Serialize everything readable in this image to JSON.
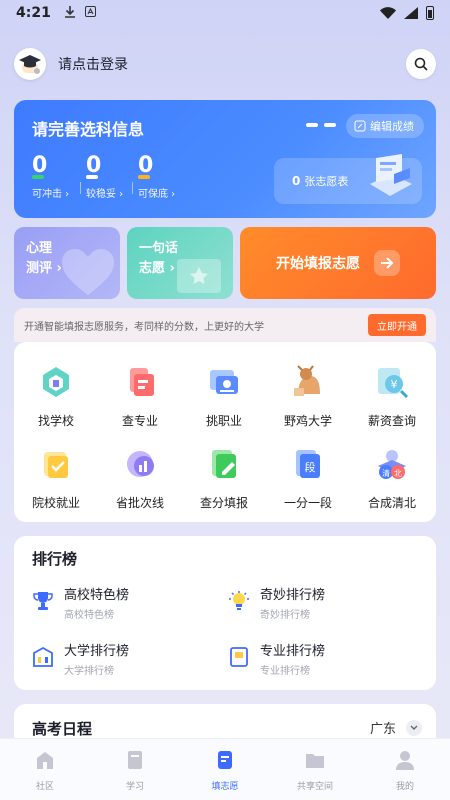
{
  "status_bar": {
    "time": "4:21"
  },
  "header": {
    "login_text": "请点击登录"
  },
  "info_card": {
    "title": "请完善选科信息",
    "edit_label": "编辑成绩",
    "stats": [
      {
        "value": "0",
        "label": "可冲击",
        "color": "#39d36b"
      },
      {
        "value": "0",
        "label": "较稳妥",
        "color": "#ffffff"
      },
      {
        "value": "0",
        "label": "可保底",
        "color": "#ffb020"
      }
    ],
    "volunteer_count": "0",
    "volunteer_label": "张志愿表"
  },
  "feature_cards": {
    "psych": {
      "line1": "心理",
      "line2": "测评"
    },
    "wish": {
      "line1": "一句话",
      "line2": "志愿"
    },
    "start_label": "开始填报志愿"
  },
  "promo": {
    "text": "开通智能填报志愿服务，考同样的分数，上更好的大学",
    "button": "立即开通"
  },
  "tools": [
    {
      "label": "找学校",
      "icon": "school-icon"
    },
    {
      "label": "查专业",
      "icon": "major-icon"
    },
    {
      "label": "挑职业",
      "icon": "career-icon"
    },
    {
      "label": "野鸡大学",
      "icon": "fake-university-icon"
    },
    {
      "label": "薪资查询",
      "icon": "salary-icon"
    },
    {
      "label": "院校就业",
      "icon": "employment-icon"
    },
    {
      "label": "省批次线",
      "icon": "batch-line-icon"
    },
    {
      "label": "查分填报",
      "icon": "score-report-icon"
    },
    {
      "label": "一分一段",
      "icon": "score-segment-icon"
    },
    {
      "label": "合成清北",
      "icon": "qingbei-game-icon"
    }
  ],
  "rankings": {
    "title": "排行榜",
    "items": [
      {
        "title": "高校特色榜",
        "subtitle": "高校特色榜",
        "icon": "trophy-icon"
      },
      {
        "title": "奇妙排行榜",
        "subtitle": "奇妙排行榜",
        "icon": "lightbulb-icon"
      },
      {
        "title": "大学排行榜",
        "subtitle": "大学排行榜",
        "icon": "building-icon"
      },
      {
        "title": "专业排行榜",
        "subtitle": "专业排行榜",
        "icon": "book-icon"
      }
    ]
  },
  "schedule": {
    "title": "高考日程",
    "province": "广东"
  },
  "tabbar": [
    {
      "label": "社区",
      "icon": "community-icon",
      "active": false
    },
    {
      "label": "学习",
      "icon": "study-icon",
      "active": false
    },
    {
      "label": "填志愿",
      "icon": "application-icon",
      "active": true
    },
    {
      "label": "共享空间",
      "icon": "shared-space-icon",
      "active": false
    },
    {
      "label": "我的",
      "icon": "profile-icon",
      "active": false
    }
  ]
}
